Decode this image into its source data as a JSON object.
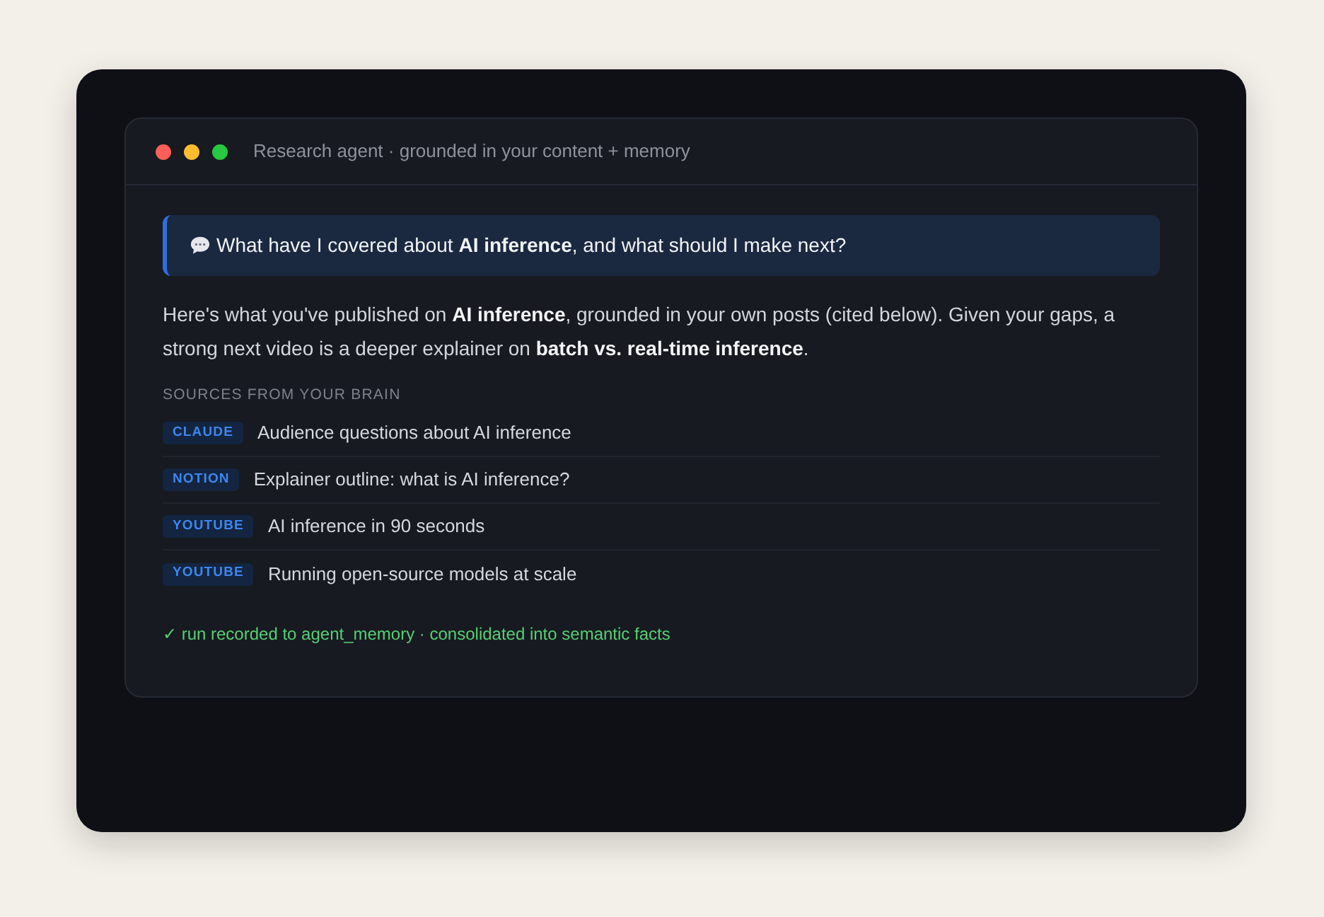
{
  "window": {
    "title": "Research agent · grounded in your content + memory"
  },
  "question": {
    "text": "What have I covered about **AI inference**, and what should I make next?"
  },
  "answer": {
    "text": "Here's what you've published on **AI inference**, grounded in your own posts (cited below). Given your gaps, a strong next video is a deeper explainer on **batch vs. real-time inference**."
  },
  "sources": {
    "heading": "SOURCES FROM YOUR BRAIN",
    "items": [
      {
        "badge": "CLAUDE",
        "title": "Audience questions about AI inference"
      },
      {
        "badge": "NOTION",
        "title": "Explainer outline: what is AI inference?"
      },
      {
        "badge": "YOUTUBE",
        "title": "AI inference in 90 seconds"
      },
      {
        "badge": "YOUTUBE",
        "title": "Running open-source models at scale"
      }
    ]
  },
  "status": {
    "text": "✓ run recorded to agent_memory · consolidated into semantic facts"
  }
}
